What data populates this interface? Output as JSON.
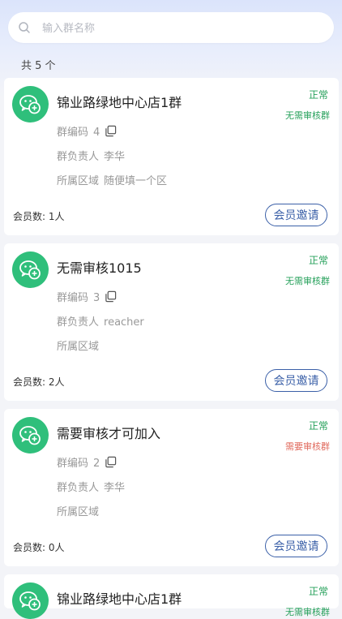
{
  "search": {
    "placeholder": "输入群名称"
  },
  "count_label": "共 5 个",
  "groups": [
    {
      "name": "锦业路绿地中心店1群",
      "code_label": "群编码",
      "code": "4",
      "owner_label": "群负责人",
      "owner": "李华",
      "region_label": "所属区域",
      "region": "随便填一个区",
      "members": "会员数: 1人",
      "status": "正常",
      "review": "无需审核群",
      "invite": "会员邀请"
    },
    {
      "name": "无需审核1015",
      "code_label": "群编码",
      "code": "3",
      "owner_label": "群负责人",
      "owner": "reacher",
      "region_label": "所属区域",
      "region": "",
      "members": "会员数: 2人",
      "status": "正常",
      "review": "无需审核群",
      "invite": "会员邀请"
    },
    {
      "name": "需要审核才可加入",
      "code_label": "群编码",
      "code": "2",
      "owner_label": "群负责人",
      "owner": "李华",
      "region_label": "所属区域",
      "region": "",
      "members": "会员数: 0人",
      "status": "正常",
      "review": "需要审核群",
      "invite": "会员邀请"
    },
    {
      "name": "锦业路绿地中心店1群",
      "status": "正常",
      "review": "无需审核群"
    }
  ],
  "colors": {
    "accent": "#3b60a8",
    "avatar": "#2fbf7b",
    "ok": "#25a05a",
    "need_review": "#e0685b"
  },
  "icons": {
    "search": "search-icon",
    "avatar": "wechat-group-icon",
    "copy": "copy-icon"
  }
}
